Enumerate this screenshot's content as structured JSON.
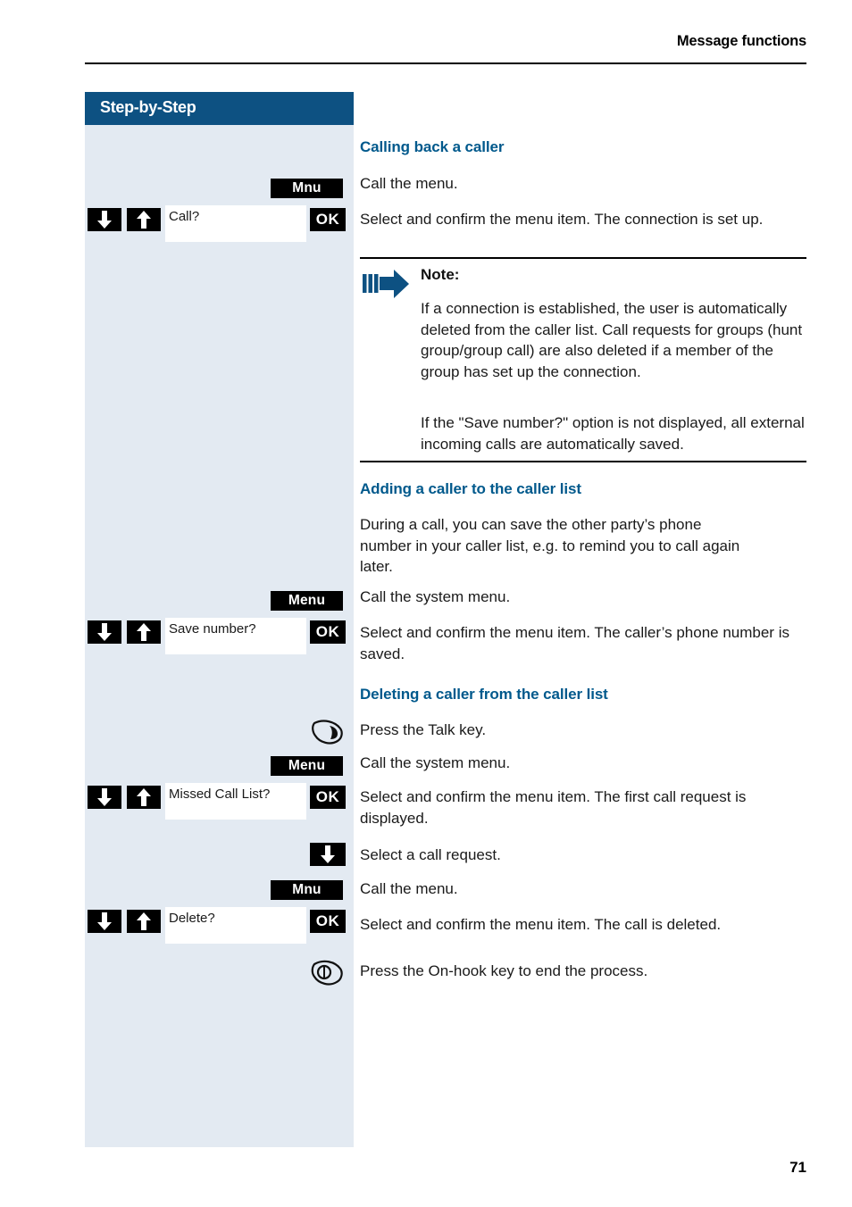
{
  "header": {
    "running_title": "Message functions"
  },
  "sidebar": {
    "title": "Step-by-Step",
    "steps": [
      {
        "key": "mnu-key-1",
        "label": "Mnu"
      },
      {
        "key": "down-key-1",
        "label": "down-arrow-icon"
      },
      {
        "key": "up-key-1",
        "label": "up-arrow-icon"
      },
      {
        "key": "display-1",
        "label": "Call?"
      },
      {
        "key": "ok-key-1",
        "label": "OK"
      },
      {
        "key": "menu-key-2",
        "label": "Menu"
      },
      {
        "key": "down-key-2",
        "label": "down-arrow-icon"
      },
      {
        "key": "up-key-2",
        "label": "up-arrow-icon"
      },
      {
        "key": "display-2",
        "label": "Save number?"
      },
      {
        "key": "ok-key-2",
        "label": "OK"
      },
      {
        "key": "talk-key",
        "label": "talk-key-icon"
      },
      {
        "key": "menu-key-3",
        "label": "Menu"
      },
      {
        "key": "down-key-3",
        "label": "down-arrow-icon"
      },
      {
        "key": "up-key-3",
        "label": "up-arrow-icon"
      },
      {
        "key": "display-3",
        "label": "Missed Call List?"
      },
      {
        "key": "ok-key-3",
        "label": "OK"
      },
      {
        "key": "down-key-solo",
        "label": "down-arrow-icon"
      },
      {
        "key": "mnu-key-4",
        "label": "Mnu"
      },
      {
        "key": "down-key-4",
        "label": "down-arrow-icon"
      },
      {
        "key": "up-key-4",
        "label": "up-arrow-icon"
      },
      {
        "key": "display-4",
        "label": "Delete?"
      },
      {
        "key": "ok-key-4",
        "label": "OK"
      },
      {
        "key": "onhook-key",
        "label": "on-hook-key-icon"
      }
    ],
    "keys": {
      "mnu": "Mnu",
      "menu": "Menu",
      "ok": "OK"
    },
    "displays": {
      "call": "Call?",
      "save_number": "Save number?",
      "missed_call_list": "Missed Call List?",
      "delete": "Delete?"
    }
  },
  "sections": [
    {
      "heading": "Calling back a caller",
      "paragraphs": [
        "Call the menu.",
        "Select and confirm the menu item. The connection is set up."
      ]
    },
    {
      "heading": "Adding a caller to the caller list",
      "paragraphs": [
        "During a call, you can save the other party’s phone number in your caller list, e.g. to remind you to call again later.",
        "Call the system menu.",
        "Select and confirm the menu item. The caller’s phone number is saved."
      ]
    },
    {
      "heading": "Deleting a caller from the caller list",
      "paragraphs": [
        "Press the Talk key.",
        "Call the system menu.",
        "Select and confirm the menu item. The first call request is displayed.",
        "Select a call request.",
        "Call the menu.",
        "Select and confirm the menu item. The call is deleted.",
        "Press the On-hook key to end the process."
      ]
    }
  ],
  "note": {
    "title": "Note:",
    "paragraphs": [
      "If a connection is established, the user is automatically deleted from the caller list. Call requests for groups (hunt group/group call) are also deleted if a member of the group has set up the connection.",
      "If the \"Save number?\" option is not displayed, all external incoming calls are automatically saved."
    ]
  },
  "footer": {
    "page_number": "71"
  },
  "colors": {
    "sidebar_header": "#0d5182",
    "sidebar_bg": "#e3eaf2",
    "heading": "#00598c",
    "note_arrow": "#0d5182"
  }
}
